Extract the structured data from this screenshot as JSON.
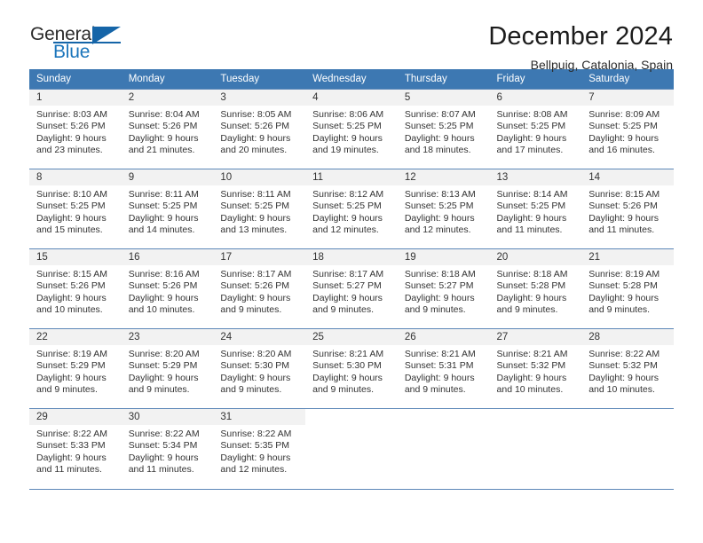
{
  "brand": {
    "name_top": "General",
    "name_bottom": "Blue"
  },
  "header": {
    "title": "December 2024",
    "subtitle": "Bellpuig, Catalonia, Spain"
  },
  "theme": {
    "header_blue": "#3d78b2",
    "brand_blue": "#1b75bb",
    "grid_line": "#5c87b8",
    "daynum_band": "#f2f2f2",
    "text": "#333333"
  },
  "weekdays": [
    "Sunday",
    "Monday",
    "Tuesday",
    "Wednesday",
    "Thursday",
    "Friday",
    "Saturday"
  ],
  "labels": {
    "sunrise_prefix": "Sunrise:",
    "sunset_prefix": "Sunset:",
    "daylight_prefix": "Daylight:"
  },
  "weeks": [
    [
      {
        "day": "1",
        "sunrise": "Sunrise: 8:03 AM",
        "sunset": "Sunset: 5:26 PM",
        "daylight_line1": "Daylight: 9 hours",
        "daylight_line2": "and 23 minutes."
      },
      {
        "day": "2",
        "sunrise": "Sunrise: 8:04 AM",
        "sunset": "Sunset: 5:26 PM",
        "daylight_line1": "Daylight: 9 hours",
        "daylight_line2": "and 21 minutes."
      },
      {
        "day": "3",
        "sunrise": "Sunrise: 8:05 AM",
        "sunset": "Sunset: 5:26 PM",
        "daylight_line1": "Daylight: 9 hours",
        "daylight_line2": "and 20 minutes."
      },
      {
        "day": "4",
        "sunrise": "Sunrise: 8:06 AM",
        "sunset": "Sunset: 5:25 PM",
        "daylight_line1": "Daylight: 9 hours",
        "daylight_line2": "and 19 minutes."
      },
      {
        "day": "5",
        "sunrise": "Sunrise: 8:07 AM",
        "sunset": "Sunset: 5:25 PM",
        "daylight_line1": "Daylight: 9 hours",
        "daylight_line2": "and 18 minutes."
      },
      {
        "day": "6",
        "sunrise": "Sunrise: 8:08 AM",
        "sunset": "Sunset: 5:25 PM",
        "daylight_line1": "Daylight: 9 hours",
        "daylight_line2": "and 17 minutes."
      },
      {
        "day": "7",
        "sunrise": "Sunrise: 8:09 AM",
        "sunset": "Sunset: 5:25 PM",
        "daylight_line1": "Daylight: 9 hours",
        "daylight_line2": "and 16 minutes."
      }
    ],
    [
      {
        "day": "8",
        "sunrise": "Sunrise: 8:10 AM",
        "sunset": "Sunset: 5:25 PM",
        "daylight_line1": "Daylight: 9 hours",
        "daylight_line2": "and 15 minutes."
      },
      {
        "day": "9",
        "sunrise": "Sunrise: 8:11 AM",
        "sunset": "Sunset: 5:25 PM",
        "daylight_line1": "Daylight: 9 hours",
        "daylight_line2": "and 14 minutes."
      },
      {
        "day": "10",
        "sunrise": "Sunrise: 8:11 AM",
        "sunset": "Sunset: 5:25 PM",
        "daylight_line1": "Daylight: 9 hours",
        "daylight_line2": "and 13 minutes."
      },
      {
        "day": "11",
        "sunrise": "Sunrise: 8:12 AM",
        "sunset": "Sunset: 5:25 PM",
        "daylight_line1": "Daylight: 9 hours",
        "daylight_line2": "and 12 minutes."
      },
      {
        "day": "12",
        "sunrise": "Sunrise: 8:13 AM",
        "sunset": "Sunset: 5:25 PM",
        "daylight_line1": "Daylight: 9 hours",
        "daylight_line2": "and 12 minutes."
      },
      {
        "day": "13",
        "sunrise": "Sunrise: 8:14 AM",
        "sunset": "Sunset: 5:25 PM",
        "daylight_line1": "Daylight: 9 hours",
        "daylight_line2": "and 11 minutes."
      },
      {
        "day": "14",
        "sunrise": "Sunrise: 8:15 AM",
        "sunset": "Sunset: 5:26 PM",
        "daylight_line1": "Daylight: 9 hours",
        "daylight_line2": "and 11 minutes."
      }
    ],
    [
      {
        "day": "15",
        "sunrise": "Sunrise: 8:15 AM",
        "sunset": "Sunset: 5:26 PM",
        "daylight_line1": "Daylight: 9 hours",
        "daylight_line2": "and 10 minutes."
      },
      {
        "day": "16",
        "sunrise": "Sunrise: 8:16 AM",
        "sunset": "Sunset: 5:26 PM",
        "daylight_line1": "Daylight: 9 hours",
        "daylight_line2": "and 10 minutes."
      },
      {
        "day": "17",
        "sunrise": "Sunrise: 8:17 AM",
        "sunset": "Sunset: 5:26 PM",
        "daylight_line1": "Daylight: 9 hours",
        "daylight_line2": "and 9 minutes."
      },
      {
        "day": "18",
        "sunrise": "Sunrise: 8:17 AM",
        "sunset": "Sunset: 5:27 PM",
        "daylight_line1": "Daylight: 9 hours",
        "daylight_line2": "and 9 minutes."
      },
      {
        "day": "19",
        "sunrise": "Sunrise: 8:18 AM",
        "sunset": "Sunset: 5:27 PM",
        "daylight_line1": "Daylight: 9 hours",
        "daylight_line2": "and 9 minutes."
      },
      {
        "day": "20",
        "sunrise": "Sunrise: 8:18 AM",
        "sunset": "Sunset: 5:28 PM",
        "daylight_line1": "Daylight: 9 hours",
        "daylight_line2": "and 9 minutes."
      },
      {
        "day": "21",
        "sunrise": "Sunrise: 8:19 AM",
        "sunset": "Sunset: 5:28 PM",
        "daylight_line1": "Daylight: 9 hours",
        "daylight_line2": "and 9 minutes."
      }
    ],
    [
      {
        "day": "22",
        "sunrise": "Sunrise: 8:19 AM",
        "sunset": "Sunset: 5:29 PM",
        "daylight_line1": "Daylight: 9 hours",
        "daylight_line2": "and 9 minutes."
      },
      {
        "day": "23",
        "sunrise": "Sunrise: 8:20 AM",
        "sunset": "Sunset: 5:29 PM",
        "daylight_line1": "Daylight: 9 hours",
        "daylight_line2": "and 9 minutes."
      },
      {
        "day": "24",
        "sunrise": "Sunrise: 8:20 AM",
        "sunset": "Sunset: 5:30 PM",
        "daylight_line1": "Daylight: 9 hours",
        "daylight_line2": "and 9 minutes."
      },
      {
        "day": "25",
        "sunrise": "Sunrise: 8:21 AM",
        "sunset": "Sunset: 5:30 PM",
        "daylight_line1": "Daylight: 9 hours",
        "daylight_line2": "and 9 minutes."
      },
      {
        "day": "26",
        "sunrise": "Sunrise: 8:21 AM",
        "sunset": "Sunset: 5:31 PM",
        "daylight_line1": "Daylight: 9 hours",
        "daylight_line2": "and 9 minutes."
      },
      {
        "day": "27",
        "sunrise": "Sunrise: 8:21 AM",
        "sunset": "Sunset: 5:32 PM",
        "daylight_line1": "Daylight: 9 hours",
        "daylight_line2": "and 10 minutes."
      },
      {
        "day": "28",
        "sunrise": "Sunrise: 8:22 AM",
        "sunset": "Sunset: 5:32 PM",
        "daylight_line1": "Daylight: 9 hours",
        "daylight_line2": "and 10 minutes."
      }
    ],
    [
      {
        "day": "29",
        "sunrise": "Sunrise: 8:22 AM",
        "sunset": "Sunset: 5:33 PM",
        "daylight_line1": "Daylight: 9 hours",
        "daylight_line2": "and 11 minutes."
      },
      {
        "day": "30",
        "sunrise": "Sunrise: 8:22 AM",
        "sunset": "Sunset: 5:34 PM",
        "daylight_line1": "Daylight: 9 hours",
        "daylight_line2": "and 11 minutes."
      },
      {
        "day": "31",
        "sunrise": "Sunrise: 8:22 AM",
        "sunset": "Sunset: 5:35 PM",
        "daylight_line1": "Daylight: 9 hours",
        "daylight_line2": "and 12 minutes."
      },
      null,
      null,
      null,
      null
    ]
  ]
}
